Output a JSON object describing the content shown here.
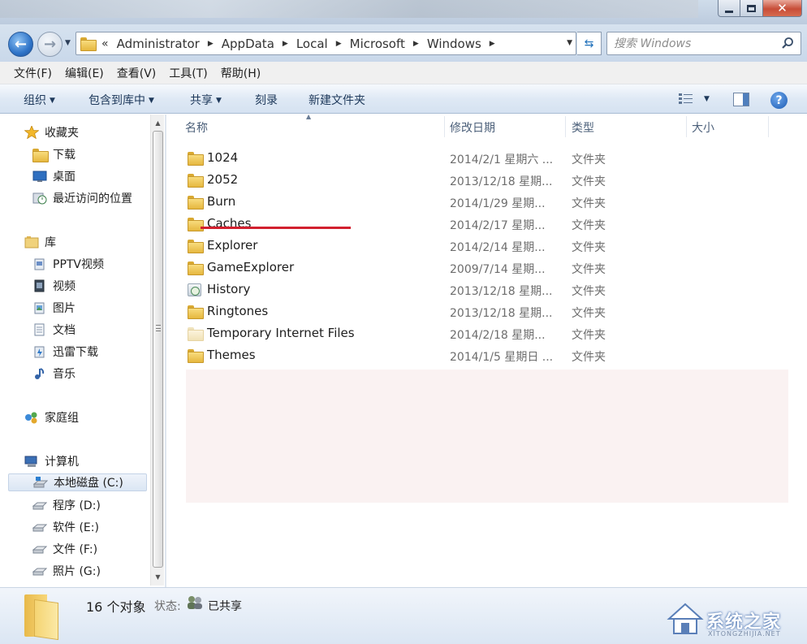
{
  "window": {
    "min_icon": "minimize-icon",
    "max_icon": "maximize-icon",
    "close_label": "✕"
  },
  "address": {
    "overflow": "«",
    "crumbs": [
      "Administrator",
      "AppData",
      "Local",
      "Microsoft",
      "Windows"
    ],
    "search_placeholder": "搜索 Windows"
  },
  "menu": [
    "文件(F)",
    "编辑(E)",
    "查看(V)",
    "工具(T)",
    "帮助(H)"
  ],
  "toolbar": {
    "organize": "组织",
    "include_library": "包含到库中",
    "share": "共享",
    "burn": "刻录",
    "new_folder": "新建文件夹",
    "help": "?"
  },
  "nav": {
    "favorites": "收藏夹",
    "downloads": "下载",
    "desktop": "桌面",
    "recent": "最近访问的位置",
    "libraries": "库",
    "lib_items": [
      "PPTV视频",
      "视频",
      "图片",
      "文档",
      "迅雷下载",
      "音乐"
    ],
    "homegroup": "家庭组",
    "computer": "计算机",
    "drives": [
      "本地磁盘 (C:)",
      "程序 (D:)",
      "软件 (E:)",
      "文件 (F:)",
      "照片 (G:)"
    ]
  },
  "columns": {
    "name": "名称",
    "date": "修改日期",
    "type": "类型",
    "size": "大小"
  },
  "files": [
    {
      "name": "1024",
      "date": "2014/2/1 星期六 ...",
      "type": "文件夹",
      "icon": "folder-icon"
    },
    {
      "name": "2052",
      "date": "2013/12/18 星期...",
      "type": "文件夹",
      "icon": "folder-icon"
    },
    {
      "name": "Burn",
      "date": "2014/1/29 星期...",
      "type": "文件夹",
      "icon": "folder-icon"
    },
    {
      "name": "Caches",
      "date": "2014/2/17 星期...",
      "type": "文件夹",
      "icon": "folder-icon"
    },
    {
      "name": "Explorer",
      "date": "2014/2/14 星期...",
      "type": "文件夹",
      "icon": "folder-icon"
    },
    {
      "name": "GameExplorer",
      "date": "2009/7/14 星期...",
      "type": "文件夹",
      "icon": "folder-icon"
    },
    {
      "name": "History",
      "date": "2013/12/18 星期...",
      "type": "文件夹",
      "icon": "history-folder-icon"
    },
    {
      "name": "Ringtones",
      "date": "2013/12/18 星期...",
      "type": "文件夹",
      "icon": "folder-icon"
    },
    {
      "name": "Temporary Internet Files",
      "date": "2014/2/18 星期...",
      "type": "文件夹",
      "icon": "hidden-folder-icon"
    },
    {
      "name": "Themes",
      "date": "2014/1/5 星期日 ...",
      "type": "文件夹",
      "icon": "folder-icon"
    }
  ],
  "status": {
    "count": "16 个对象",
    "state_label": "状态:",
    "state_value": "已共享"
  },
  "watermark": {
    "text": "系统之家",
    "sub": "XITONGZHIJIA.NET"
  },
  "colors": {
    "accent": "#1e395b",
    "highlight_underline": "#d2202f",
    "folder": "#e6b73f"
  }
}
